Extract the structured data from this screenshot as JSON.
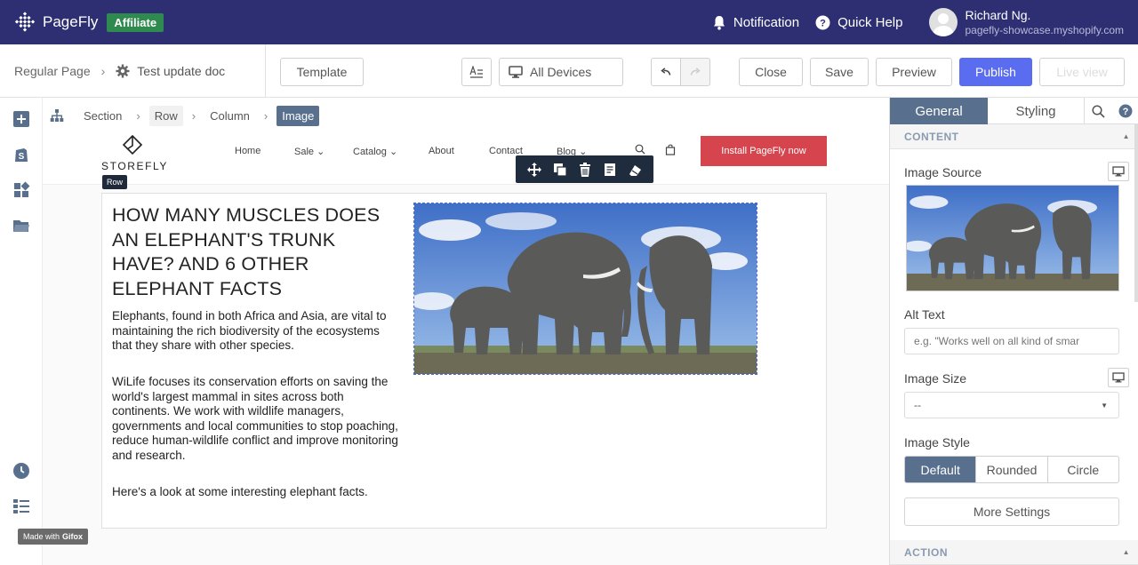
{
  "app": {
    "name": "PageFly",
    "badge": "Affiliate",
    "notification_label": "Notification",
    "help_label": "Quick Help",
    "user_name": "Richard Ng.",
    "user_shop": "pagefly-showcase.myshopify.com"
  },
  "toolbar": {
    "page_type": "Regular Page",
    "doc_name": "Test update doc",
    "template_label": "Template",
    "devices_label": "All Devices",
    "close_label": "Close",
    "save_label": "Save",
    "preview_label": "Preview",
    "publish_label": "Publish",
    "live_view_label": "Live view"
  },
  "element_path": [
    "Section",
    "Row",
    "Column",
    "Image"
  ],
  "store": {
    "logo": "STOREFLY",
    "nav": [
      "Home",
      "Sale",
      "Catalog",
      "About",
      "Contact",
      "Blog"
    ],
    "install_button": "Install PageFly now",
    "row_tooltip": "Row"
  },
  "article": {
    "headline": "HOW MANY MUSCLES DOES AN ELEPHANT'S TRUNK HAVE? AND 6 OTHER ELEPHANT FACTS",
    "p1": "Elephants, found in both Africa and Asia, are vital to maintaining the rich biodiversity of the ecosystems that they share with other species.",
    "p2": "WiLife focuses its conservation efforts on saving the world's largest mammal in sites across both continents. We work with wildlife managers, governments and local communities to stop poaching, reduce human-wildlife conflict and improve monitoring and research.",
    "p3": "Here's a look at some interesting elephant facts."
  },
  "watermark": {
    "prefix": "Made with",
    "brand": "Gifox"
  },
  "panel": {
    "tab_general": "General",
    "tab_styling": "Styling",
    "content_header": "CONTENT",
    "image_source_label": "Image Source",
    "alt_text_label": "Alt Text",
    "alt_text_placeholder": "e.g. \"Works well on all kind of smar",
    "image_size_label": "Image Size",
    "image_size_value": "--",
    "image_style_label": "Image Style",
    "styles": [
      "Default",
      "Rounded",
      "Circle"
    ],
    "selected_style": "Default",
    "more_settings": "More Settings",
    "action_header": "ACTION"
  },
  "colors": {
    "topbar": "#2d2f72",
    "affiliate_badge": "#2e8a4f",
    "publish": "#5a6df0",
    "active_tab": "#586f8d",
    "install_button": "#d6454d"
  }
}
